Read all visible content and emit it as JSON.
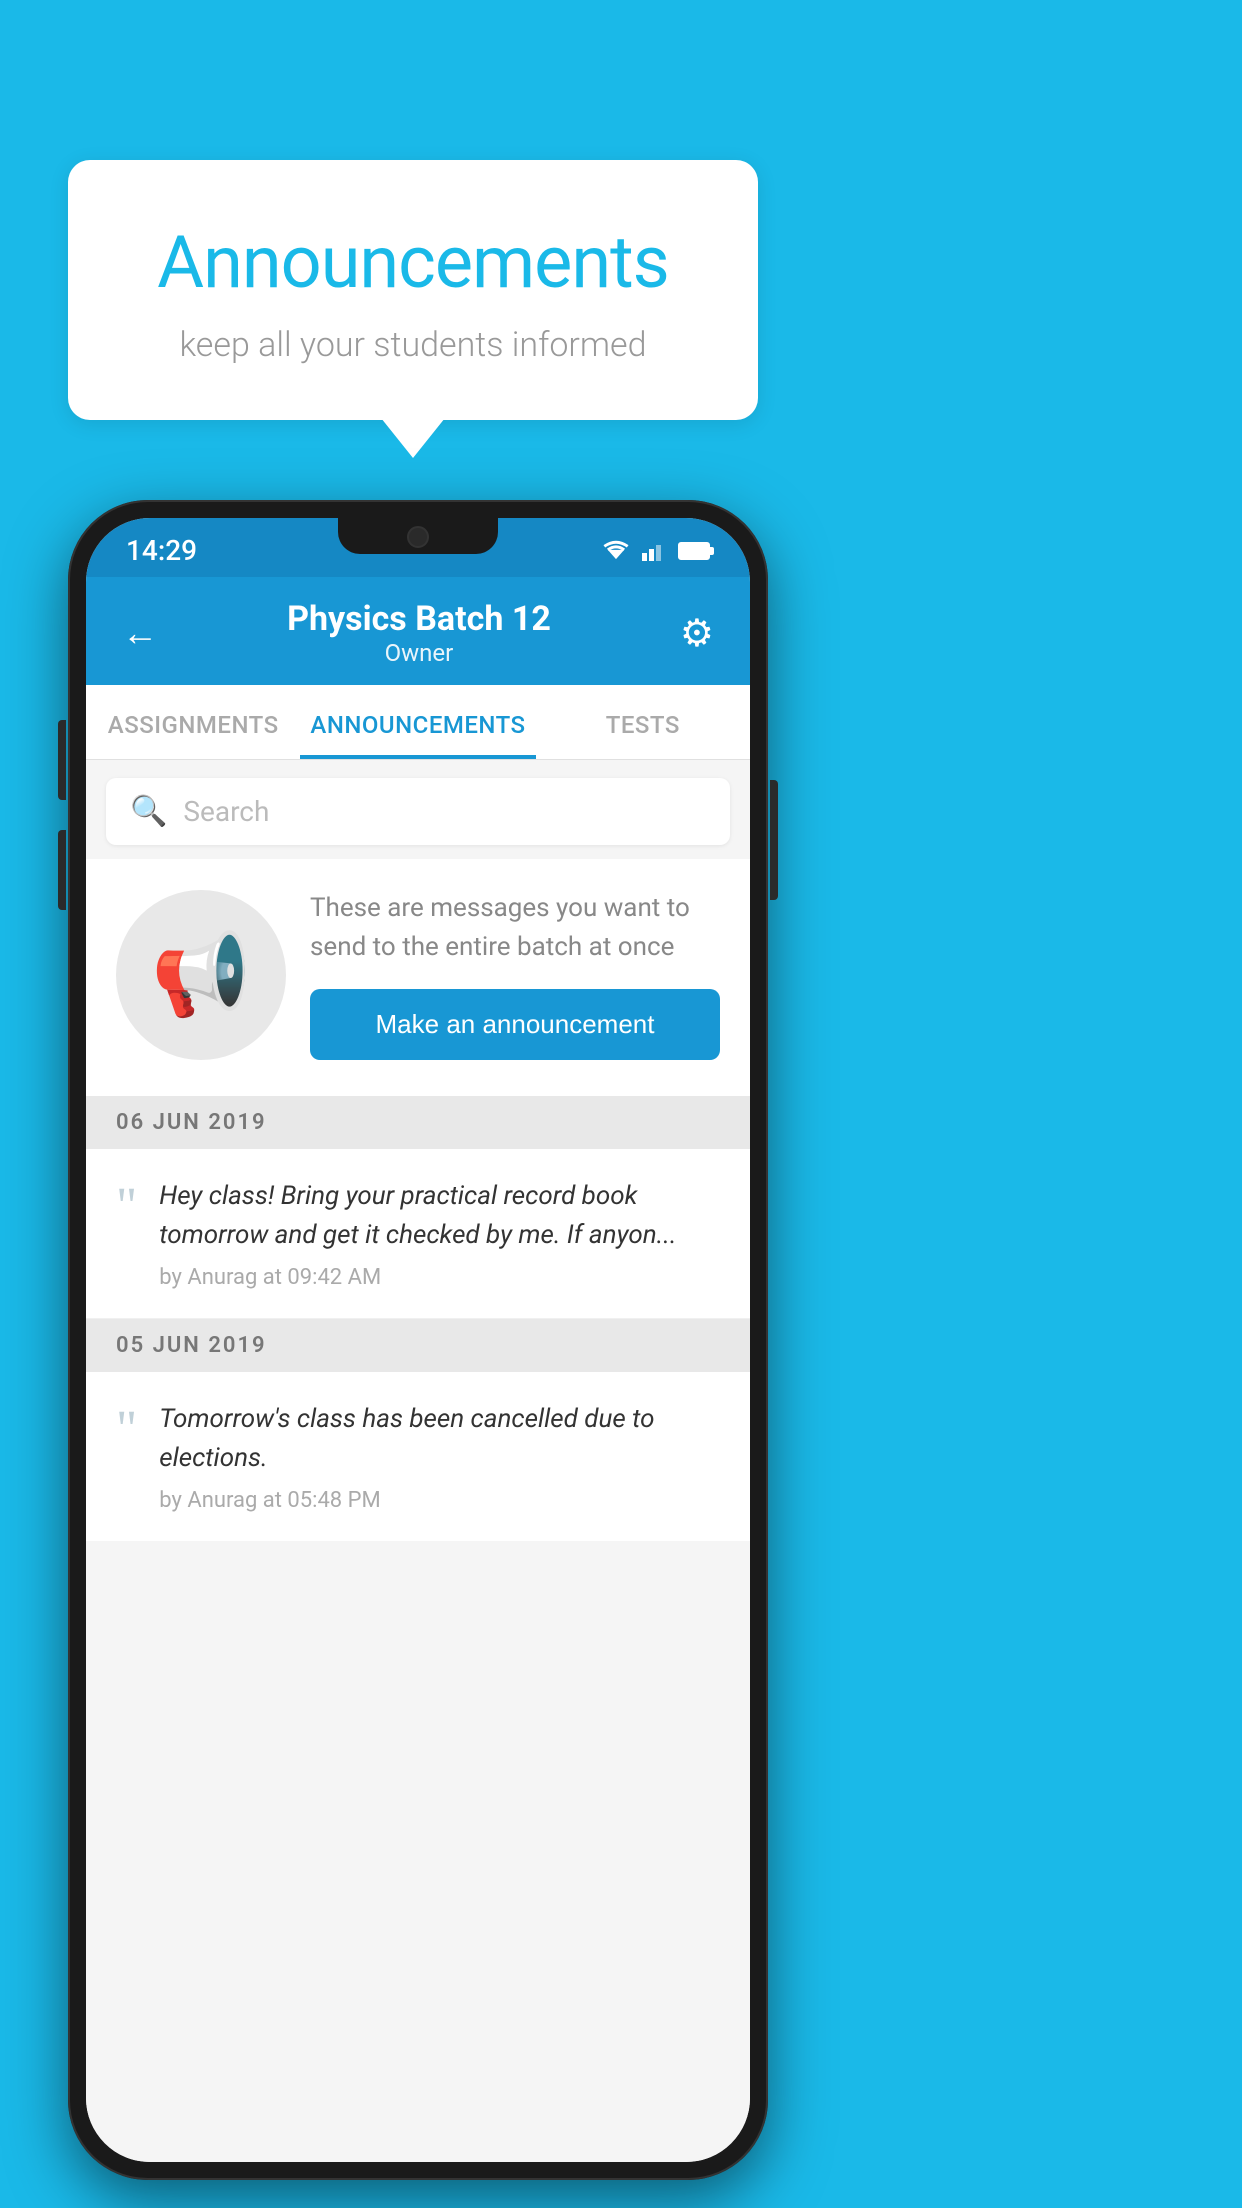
{
  "background_color": "#1ab9e8",
  "speech_bubble": {
    "title": "Announcements",
    "subtitle": "keep all your students informed"
  },
  "phone": {
    "status_bar": {
      "time": "14:29"
    },
    "app_bar": {
      "back_label": "←",
      "title": "Physics Batch 12",
      "subtitle": "Owner",
      "gear_label": "⚙"
    },
    "tabs": [
      {
        "label": "ASSIGNMENTS",
        "active": false
      },
      {
        "label": "ANNOUNCEMENTS",
        "active": true
      },
      {
        "label": "TESTS",
        "active": false
      }
    ],
    "search": {
      "placeholder": "Search"
    },
    "promo": {
      "description_text": "These are messages you want to send to the entire batch at once",
      "button_label": "Make an announcement"
    },
    "announcements": [
      {
        "date": "06  JUN  2019",
        "text": "Hey class! Bring your practical record book tomorrow and get it checked by me. If anyon...",
        "meta": "by Anurag at 09:42 AM"
      },
      {
        "date": "05  JUN  2019",
        "text": "Tomorrow's class has been cancelled due to elections.",
        "meta": "by Anurag at 05:48 PM"
      }
    ]
  }
}
